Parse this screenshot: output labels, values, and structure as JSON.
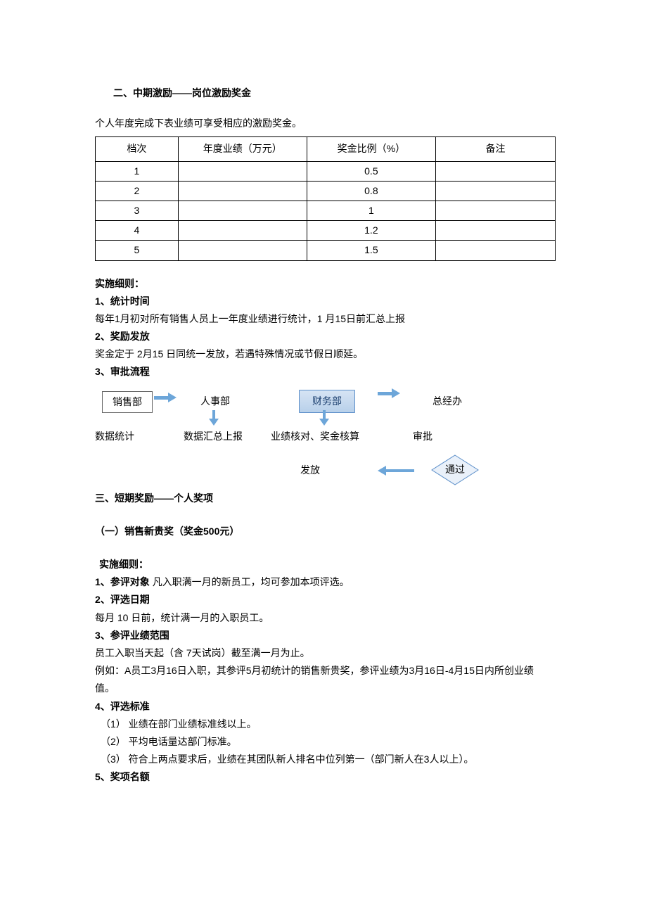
{
  "section2": {
    "title": "二、中期激励——岗位激励奖金",
    "intro": "个人年度完成下表业绩可享受相应的激励奖金。",
    "table": {
      "headers": [
        "档次",
        "年度业绩（万元）",
        "奖金比例（%）",
        "备注"
      ],
      "rows": [
        {
          "tier": "1",
          "perf": "",
          "ratio": "0.5",
          "note": ""
        },
        {
          "tier": "2",
          "perf": "",
          "ratio": "0.8",
          "note": ""
        },
        {
          "tier": "3",
          "perf": "",
          "ratio": "1",
          "note": ""
        },
        {
          "tier": "4",
          "perf": "",
          "ratio": "1.2",
          "note": ""
        },
        {
          "tier": "5",
          "perf": "",
          "ratio": "1.5",
          "note": ""
        }
      ]
    },
    "rules": {
      "heading": "实施细则：",
      "r1_title": "1、统计时间",
      "r1_body": "每年1月初对所有销售人员上一年度业绩进行统计，1 月15日前汇总上报",
      "r2_title": "2、奖励发放",
      "r2_body": "奖金定于 2月15 日同统一发放，若遇特殊情况或节假日顺延。",
      "r3_title": "3、审批流程"
    },
    "flow": {
      "nodes": {
        "sales": "销售部",
        "hr": "人事部",
        "finance": "财务部",
        "ceo_office": "总经办"
      },
      "labels": {
        "sales": "数据统计",
        "hr": "数据汇总上报",
        "finance": "业绩核对、奖金核算",
        "ceo_office": "审批",
        "release": "发放",
        "pass": "通过"
      }
    }
  },
  "section3": {
    "title": "三、短期奖励——个人奖项",
    "award1": {
      "title": "（一）销售新贵奖（奖金500元）",
      "rules_heading": "实施细则：",
      "r1": {
        "t": "1、参评对象",
        "b": "凡入职满一月的新员工，均可参加本项评选。"
      },
      "r2": {
        "t": "2、评选日期",
        "b": "每月 10 日前，统计满一月的入职员工。"
      },
      "r3": {
        "t": "3、参评业绩范围",
        "b1": "员工入职当天起（含 7天试岗）截至满一月为止。",
        "b2": "例如：A员工3月16日入职，其参评5月初统计的销售新贵奖，参评业绩为3月16日-4月15日内所创业绩 值。"
      },
      "r4": {
        "t": "4、评选标准",
        "items": [
          "（1） 业绩在部门业绩标准线以上。",
          "（2） 平均电话量达部门标准。",
          "（3） 符合上两点要求后，业绩在其团队新人排名中位列第一（部门新人在3人以上）。"
        ]
      },
      "r5": {
        "t": "5、奖项名额"
      }
    }
  }
}
